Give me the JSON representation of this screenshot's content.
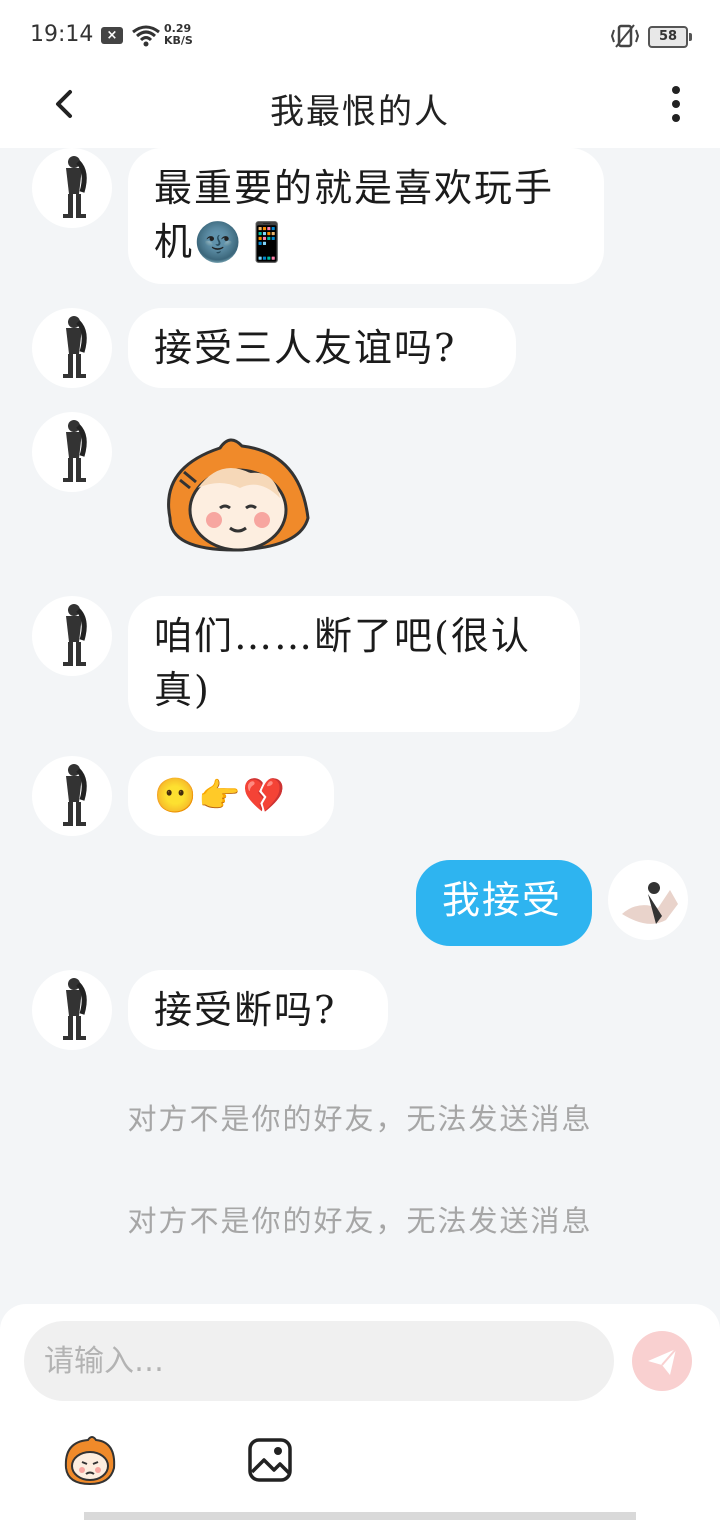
{
  "status_bar": {
    "time": "19:14",
    "speed_value": "0.29",
    "speed_unit": "KB/S",
    "battery": "58"
  },
  "header": {
    "title": "我最恨的人"
  },
  "messages": [
    {
      "from": "them",
      "text": "最重要的就是喜欢玩手机🌚📱"
    },
    {
      "from": "them",
      "text": "接受三人友谊吗?"
    },
    {
      "from": "them",
      "sticker": "orange-haired-girl-sticker"
    },
    {
      "from": "them",
      "text": "咱们……断了吧(很认真)"
    },
    {
      "from": "them",
      "text": "😶👉💔"
    },
    {
      "from": "me",
      "text": "我接受"
    },
    {
      "from": "them",
      "text": "接受断吗?"
    }
  ],
  "system_notices": [
    "对方不是你的好友，无法发送消息",
    "对方不是你的好友，无法发送消息"
  ],
  "composer": {
    "placeholder": "请输入…"
  },
  "colors": {
    "my_bubble": "#2eb4f0",
    "background": "#f3f5f7",
    "send_button": "#f9d0d0"
  }
}
